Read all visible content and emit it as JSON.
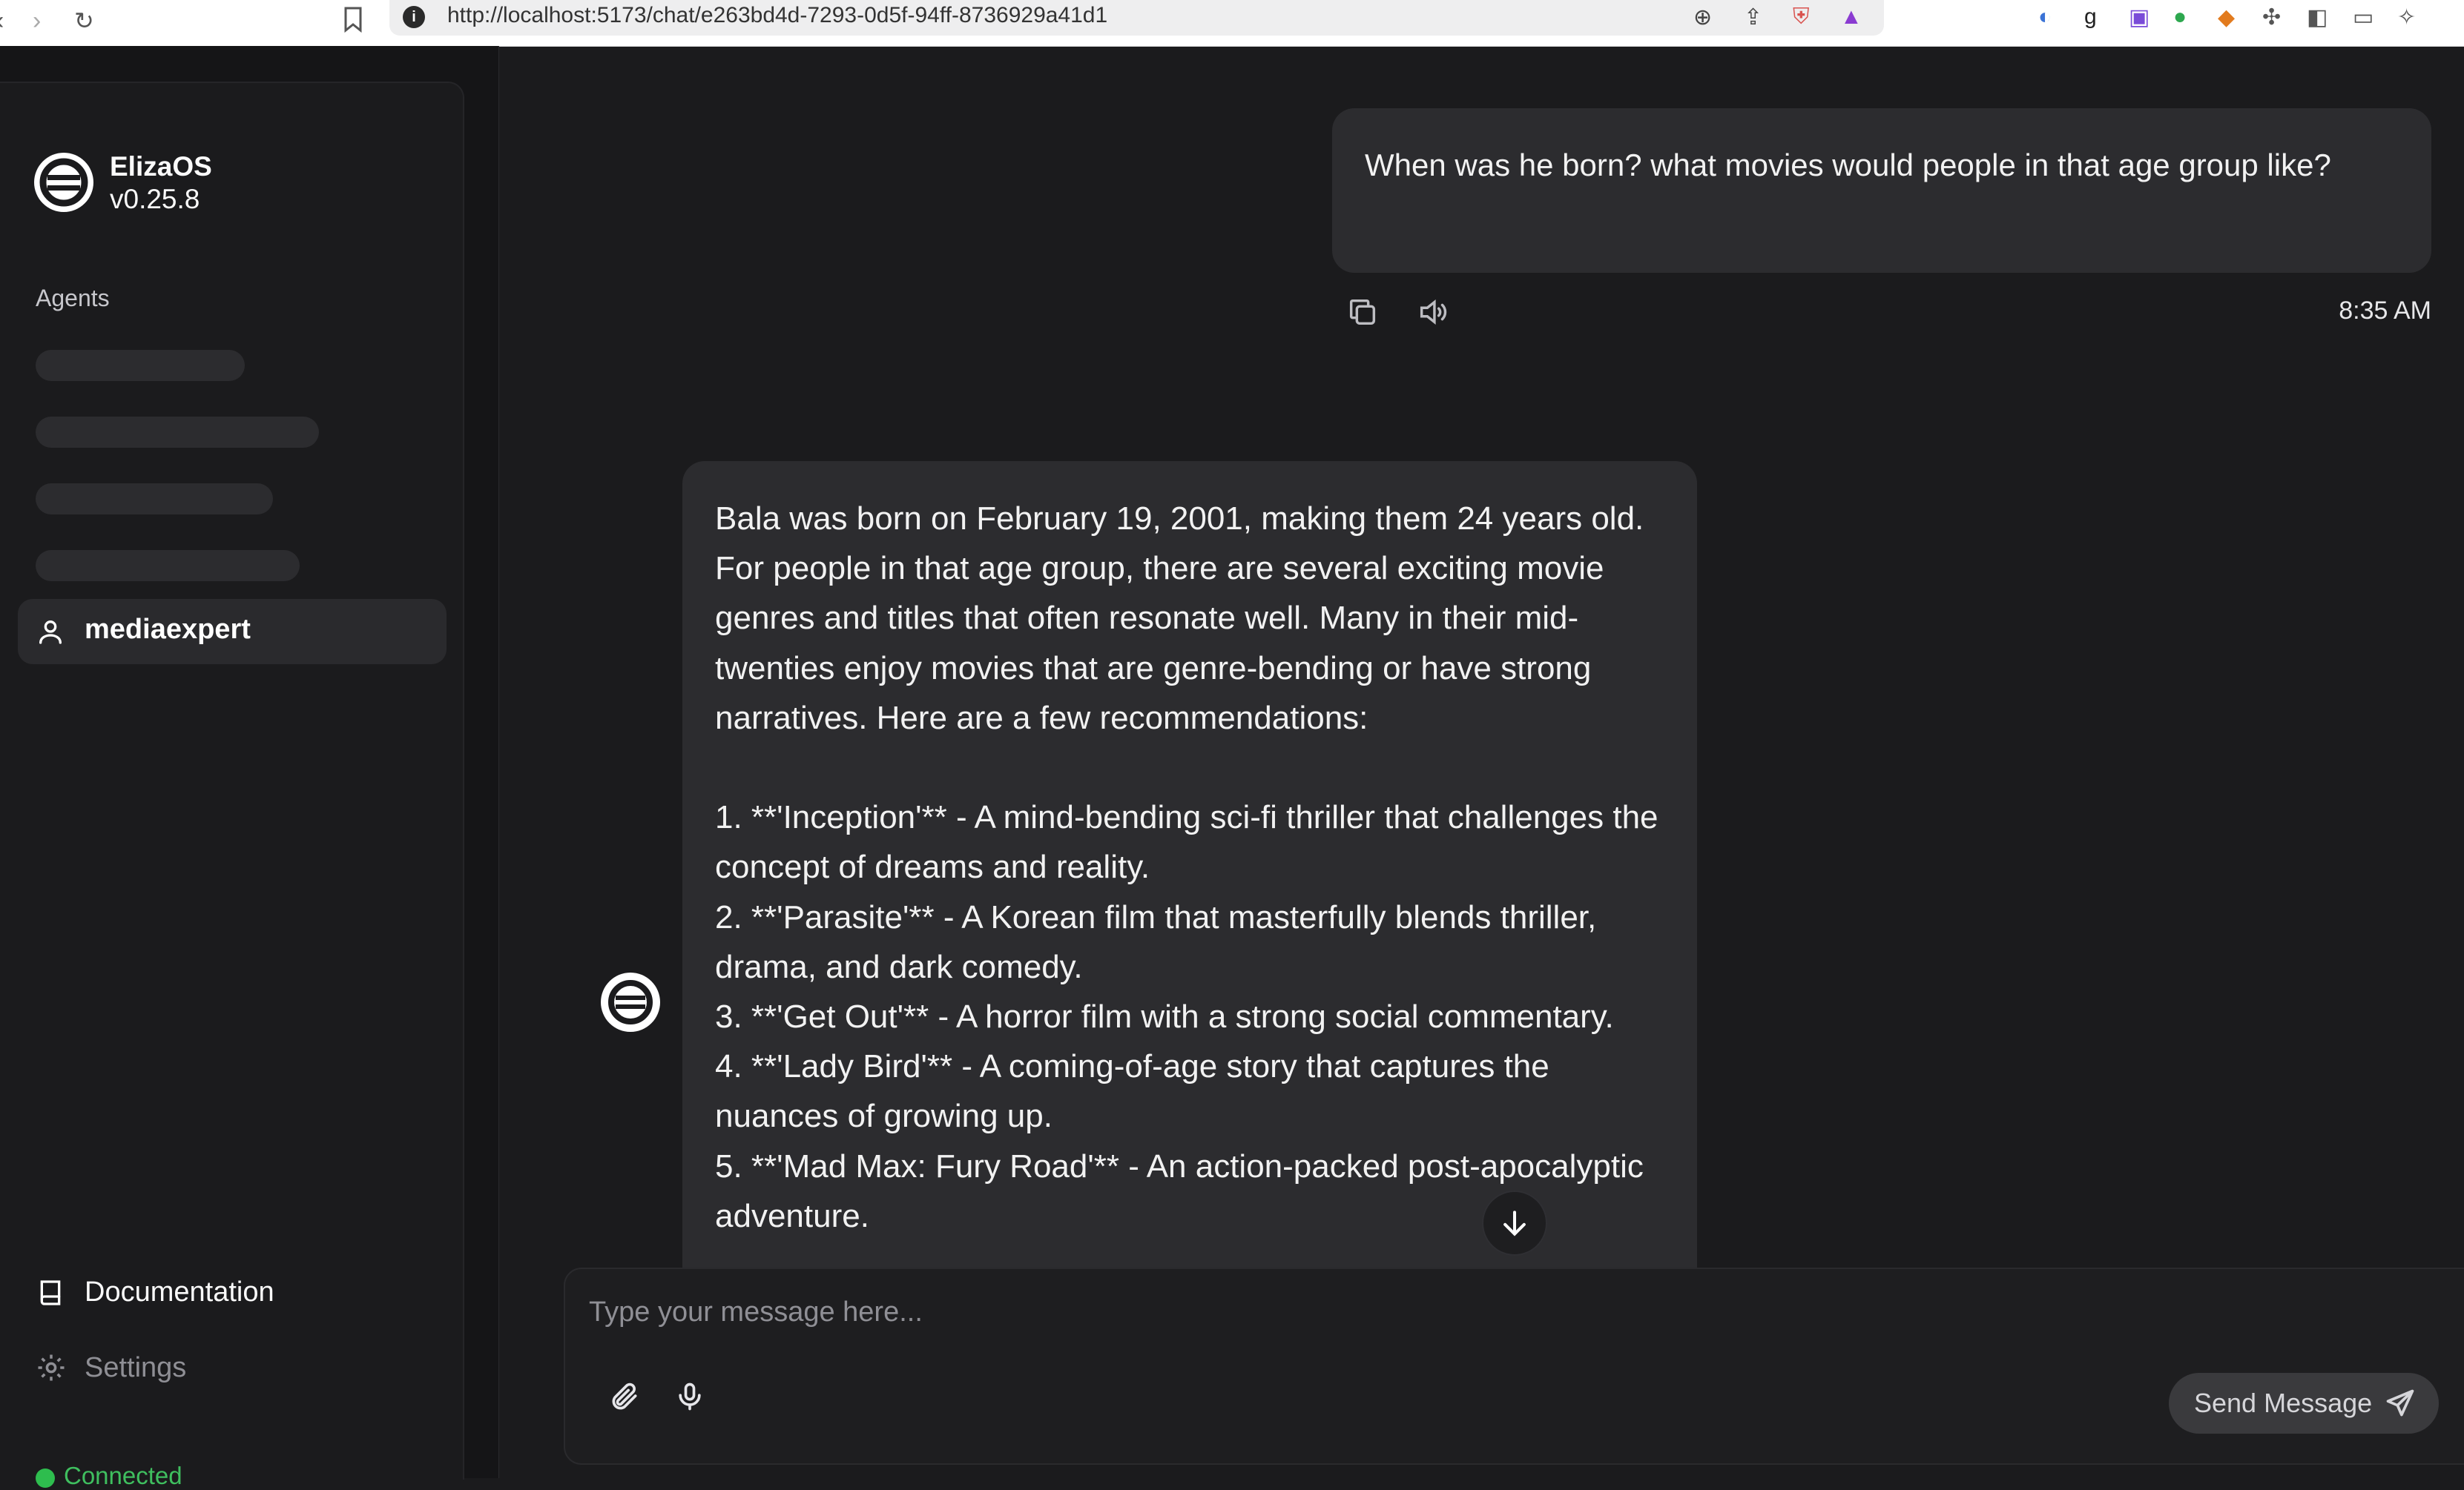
{
  "browser": {
    "url": "http://localhost:5173/chat/e263bd4d-7293-0d5f-94ff-8736929a41d1"
  },
  "sidebar": {
    "app_name": "ElizaOS",
    "version": "v0.25.8",
    "agents_heading": "Agents",
    "agents": [
      {
        "name": "mediaexpert",
        "selected": true
      }
    ],
    "documentation_label": "Documentation",
    "settings_label": "Settings",
    "status_label": "Connected",
    "status_color": "#2ebd4e"
  },
  "chat": {
    "user_message": {
      "text": "When was he born? what movies would people in that age group like?",
      "time": "8:35 AM"
    },
    "agent_message": {
      "text": "Bala was born on February 19, 2001, making them 24 years old. For people in that age group, there are several exciting movie genres and titles that often resonate well. Many in their mid-twenties enjoy movies that are genre-bending or have strong narratives. Here are a few recommendations:\n\n1. **'Inception'** - A mind-bending sci-fi thriller that challenges the concept of dreams and reality.\n2. **'Parasite'** - A Korean film that masterfully blends thriller, drama, and dark comedy.\n3. **'Get Out'** - A horror film with a strong social commentary.\n4. **'Lady Bird'** - A coming-of-age story that captures the nuances of growing up.\n5. **'Mad Max: Fury Road'** - An action-packed post-apocalyptic adventure."
    }
  },
  "composer": {
    "placeholder": "Type your message here...",
    "send_label": "Send Message"
  }
}
